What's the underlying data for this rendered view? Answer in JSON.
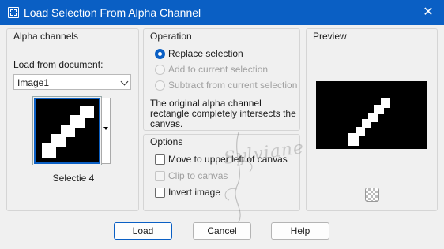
{
  "window": {
    "title": "Load Selection From Alpha Channel",
    "close_glyph": "✕"
  },
  "alpha_channels": {
    "group_title": "Alpha channels",
    "load_from_label": "Load from document:",
    "document_value": "Image1",
    "channel_caption": "Selectie 4"
  },
  "operation": {
    "group_title": "Operation",
    "options": [
      {
        "label": "Replace selection",
        "checked": true,
        "enabled": true
      },
      {
        "label": "Add to current selection",
        "checked": false,
        "enabled": false
      },
      {
        "label": "Subtract from current selection",
        "checked": false,
        "enabled": false
      }
    ],
    "description": "The original alpha channel rectangle completely intersects the canvas."
  },
  "options": {
    "group_title": "Options",
    "move_to_upper_left": {
      "label": "Move to upper left of canvas",
      "checked": false,
      "enabled": true
    },
    "clip_to_canvas": {
      "label": "Clip to canvas",
      "checked": false,
      "enabled": false
    },
    "invert_image": {
      "label": "Invert image",
      "checked": false,
      "enabled": true
    }
  },
  "preview": {
    "group_title": "Preview",
    "background_icon": "checkerboard-icon"
  },
  "buttons": {
    "load": "Load",
    "cancel": "Cancel",
    "help": "Help"
  },
  "watermark": "Sylviane",
  "colors": {
    "title_bar": "#0a5fc4",
    "accent": "#0a5fc4",
    "selection_white": "#ffffff",
    "mask_black": "#000000"
  }
}
